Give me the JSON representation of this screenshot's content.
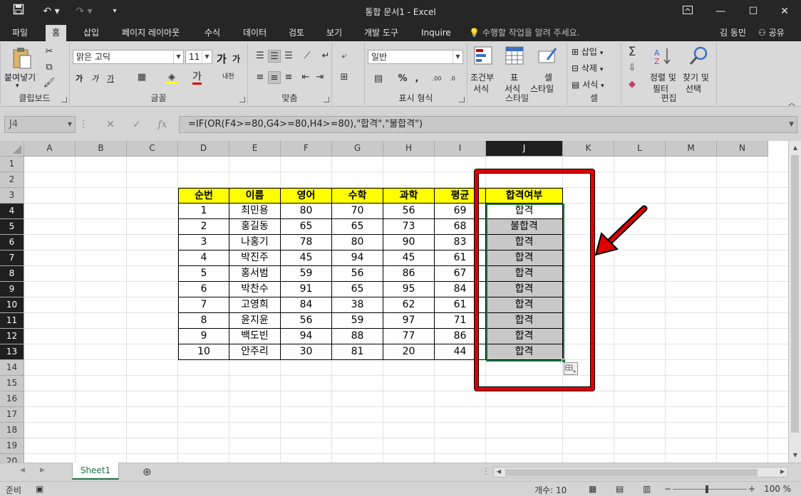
{
  "window": {
    "title": "통합 문서1 - Excel",
    "icons": [
      "save-icon",
      "undo-icon",
      "redo-icon",
      "customize-qat-icon",
      "ribbon-display-icon",
      "minimize-icon",
      "maximize-icon",
      "close-icon"
    ]
  },
  "tabs": [
    "파일",
    "홈",
    "삽입",
    "페이지 레이아웃",
    "수식",
    "데이터",
    "검토",
    "보기",
    "개발 도구",
    "Inquire"
  ],
  "active_tab": "홈",
  "tell_me": "수행할 작업을 알려 주세요.",
  "user": "김 동민",
  "share": "공유",
  "ribbon": {
    "clipboard": {
      "label": "클립보드",
      "paste": "붙여넣기"
    },
    "font": {
      "label": "글꼴",
      "name": "맑은 고딕",
      "size": "11",
      "grow": "가",
      "shrink": "가",
      "bold": "가",
      "italic": "가",
      "underline": "가",
      "color": "가",
      "phonetic": "내천"
    },
    "alignment": {
      "label": "맞춤"
    },
    "number": {
      "label": "표시 형식",
      "format": "일반"
    },
    "styles": {
      "label": "스타일",
      "conditional_1": "조건부",
      "conditional_2": "서식",
      "table_1": "표",
      "table_2": "서식",
      "cell_1": "셀",
      "cell_2": "스타일"
    },
    "cells": {
      "label": "셀",
      "insert": "삽입",
      "delete": "삭제",
      "format": "서식"
    },
    "editing": {
      "label": "편집",
      "sort_1": "정렬 및",
      "sort_2": "필터",
      "find_1": "찾기 및",
      "find_2": "선택"
    }
  },
  "formula_bar": {
    "name_box": "J4",
    "formula": "=IF(OR(F4>=80,G4>=80,H4>=80),\"합격\",\"불합격\")",
    "cancel": "✕",
    "enter": "✓",
    "fx": "fx"
  },
  "columns": [
    "A",
    "B",
    "C",
    "D",
    "E",
    "F",
    "G",
    "H",
    "I",
    "J",
    "K",
    "L",
    "M",
    "N"
  ],
  "selected_column": "J",
  "rows": [
    "1",
    "2",
    "3",
    "4",
    "5",
    "6",
    "7",
    "8",
    "9",
    "10",
    "11",
    "12",
    "13",
    "14",
    "15",
    "16",
    "17",
    "18",
    "19",
    "20"
  ],
  "table": {
    "headers": [
      "순번",
      "이름",
      "영어",
      "수학",
      "과학",
      "평균",
      "합격여부"
    ],
    "rows": [
      [
        "1",
        "최민용",
        "80",
        "70",
        "56",
        "69",
        "합격"
      ],
      [
        "2",
        "홍길동",
        "65",
        "65",
        "73",
        "68",
        "불합격"
      ],
      [
        "3",
        "나홍기",
        "78",
        "80",
        "90",
        "83",
        "합격"
      ],
      [
        "4",
        "박진주",
        "45",
        "94",
        "45",
        "61",
        "합격"
      ],
      [
        "5",
        "홍서범",
        "59",
        "56",
        "86",
        "67",
        "합격"
      ],
      [
        "6",
        "박찬수",
        "91",
        "65",
        "95",
        "84",
        "합격"
      ],
      [
        "7",
        "고영희",
        "84",
        "38",
        "62",
        "61",
        "합격"
      ],
      [
        "8",
        "윤지윤",
        "56",
        "59",
        "97",
        "71",
        "합격"
      ],
      [
        "9",
        "백도빈",
        "94",
        "88",
        "77",
        "86",
        "합격"
      ],
      [
        "10",
        "안주리",
        "30",
        "81",
        "20",
        "44",
        "합격"
      ]
    ]
  },
  "sheets": [
    "Sheet1"
  ],
  "status": {
    "ready": "준비",
    "count": "개수: 10",
    "zoom": "100 %"
  },
  "colors": {
    "accent_green": "#217346",
    "highlight_red": "#e00000",
    "header_yellow": "#ffff00",
    "selection_gray": "#c8c8c8"
  }
}
